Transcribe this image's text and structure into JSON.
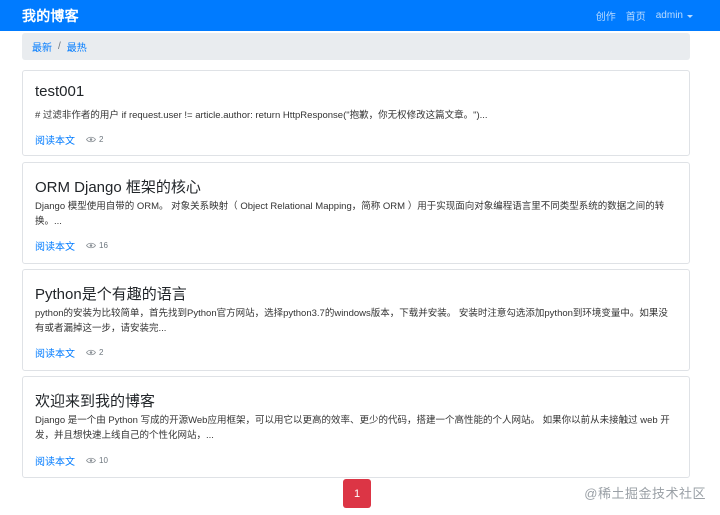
{
  "navbar": {
    "brand": "我的博客",
    "links": [
      "创作",
      "首页"
    ],
    "user": "admin"
  },
  "breadcrumb": {
    "items": [
      "最新",
      "最热"
    ],
    "separator": "/"
  },
  "articles": [
    {
      "title": "test001",
      "excerpt": "# 过滤非作者的用户 if request.user != article.author: return HttpResponse(\"抱歉，你无权修改这篇文章。\")...",
      "read_label": "阅读本文",
      "views": "2"
    },
    {
      "title": "ORM Django 框架的核心",
      "excerpt": "Django 模型使用自带的 ORM。 对象关系映射（ Object Relational Mapping，简称 ORM ）用于实现面向对象编程语言里不同类型系统的数据之间的转换。...",
      "read_label": "阅读本文",
      "views": "16"
    },
    {
      "title": "Python是个有趣的语言",
      "excerpt": "python的安装为比较简单，首先找到Python官方网站，选择python3.7的windows版本，下载并安装。 安装时注意勾选添加python到环境变量中。如果没有或者漏掉这一步，请安装完...",
      "read_label": "阅读本文",
      "views": "2"
    },
    {
      "title": "欢迎来到我的博客",
      "excerpt": "Django 是一个由 Python 写成的开源Web应用框架，可以用它以更高的效率、更少的代码，搭建一个高性能的个人网站。 如果你以前从未接触过 web 开发，并且想快速上线自己的个性化网站，...",
      "read_label": "阅读本文",
      "views": "10"
    }
  ],
  "pagination": {
    "current": "1"
  },
  "watermark": "@稀土掘金技术社区",
  "colors": {
    "primary": "#007bff",
    "danger": "#dc3545",
    "breadcrumb_bg": "#e9ecef"
  }
}
